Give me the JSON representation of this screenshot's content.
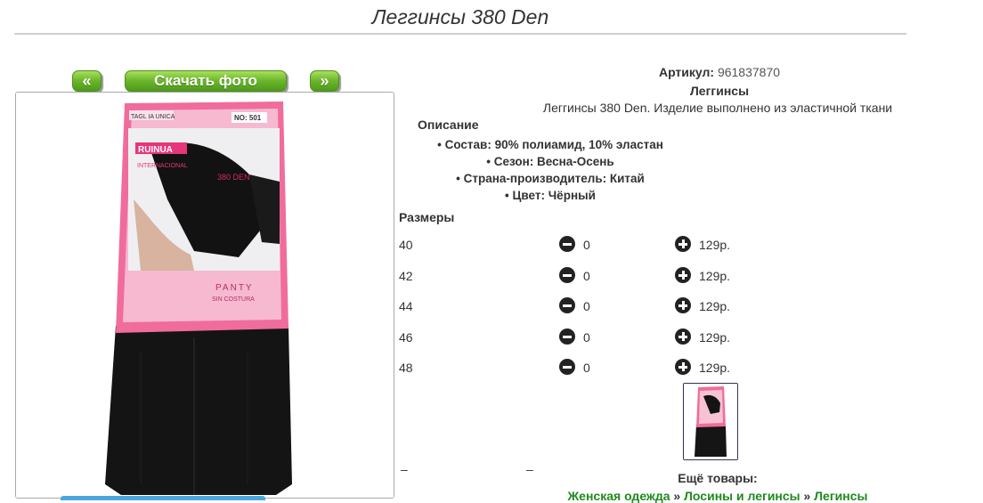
{
  "page": {
    "title": "Леггинсы 380 Den"
  },
  "nav": {
    "prev_label": "«",
    "download_label": "Скачать фото",
    "next_label": "»"
  },
  "product": {
    "article_label": "Артикул:",
    "article_value": "961837870",
    "category": "Леггинсы",
    "description": "Леггинсы 380 Den. Изделие выполнено из эластичной ткани",
    "description_heading": "Описание",
    "attributes": [
      "Состав: 90% полиамид, 10% эластан",
      "Сезон: Весна-Осень",
      "Страна-производитель: Китай",
      "Цвет: Чёрный"
    ]
  },
  "sizes": {
    "heading": "Размеры",
    "rows": [
      {
        "size": "40",
        "qty": "0",
        "price": "129р."
      },
      {
        "size": "42",
        "qty": "0",
        "price": "129р."
      },
      {
        "size": "44",
        "qty": "0",
        "price": "129р."
      },
      {
        "size": "46",
        "qty": "0",
        "price": "129р."
      },
      {
        "size": "48",
        "qty": "0",
        "price": "129р."
      }
    ]
  },
  "packaging": {
    "tag": "TAGL IA UNICA",
    "model": "NO: 501",
    "brand": "RUINUA",
    "brand_sub": "INTERNACIONAL",
    "density": "380 DEN",
    "line": "PANTY",
    "line_sub": "SIN COSTURA"
  },
  "misc": {
    "dash_1": "–",
    "dash_2": "–"
  },
  "more": {
    "heading": "Ещё товары:",
    "crumbs": [
      "Женская одежда",
      "Лосины и легинсы",
      "Легинсы"
    ],
    "separator": "»"
  },
  "colors": {
    "accent_green": "#6ab52a",
    "link_green": "#1e8a1e",
    "package_pink": "#ee4f8c"
  }
}
